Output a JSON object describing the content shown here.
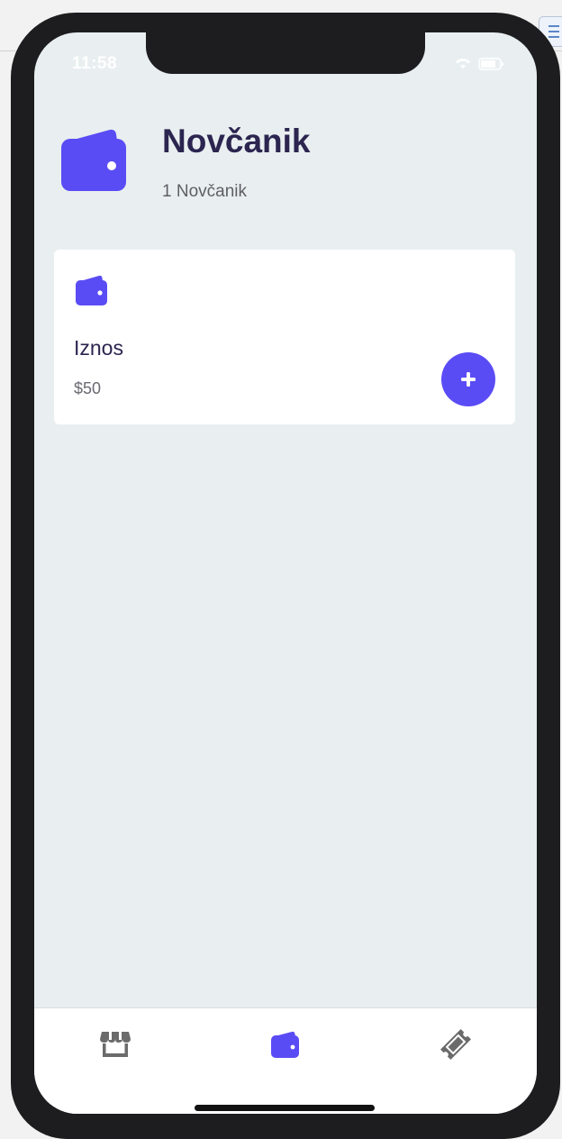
{
  "status_bar": {
    "time": "11:58"
  },
  "header": {
    "icon": "wallet-icon",
    "title": "Novčanik",
    "subtitle": "1 Novčanik"
  },
  "wallet_card": {
    "icon": "wallet-icon",
    "label": "Iznos",
    "amount": "$50",
    "add_button_icon": "plus-icon"
  },
  "bottom_nav": {
    "items": [
      {
        "icon": "store-icon",
        "active": false
      },
      {
        "icon": "wallet-icon",
        "active": true
      },
      {
        "icon": "ticket-icon",
        "active": false
      }
    ]
  },
  "colors": {
    "accent": "#5a4cf5",
    "background": "#e9eff0",
    "title_text": "#2b2550",
    "inactive_icon": "#6b6b6b"
  }
}
